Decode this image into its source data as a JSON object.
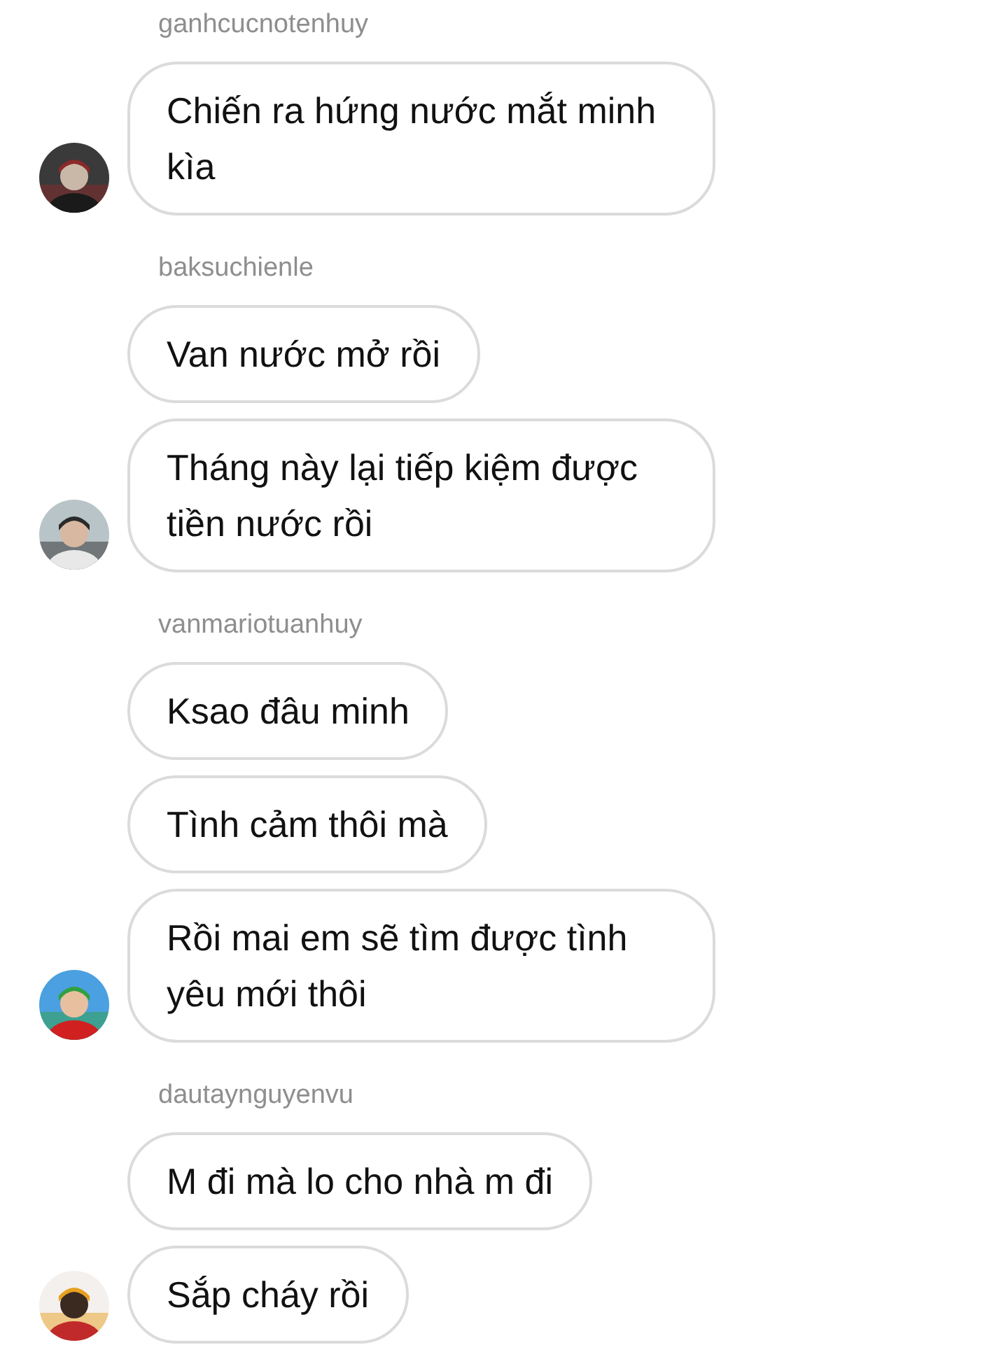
{
  "groups": [
    {
      "sender": "ganhcucnotenhuy",
      "messages": [
        "Chiến ra hứng nước mắt minh kìa"
      ]
    },
    {
      "sender": "baksuchienle",
      "messages": [
        "Van nước mở rồi",
        "Tháng này lại tiếp kiệm được tiền nước rồi"
      ]
    },
    {
      "sender": "vanmariotuanhuy",
      "messages": [
        "Ksao đâu minh",
        "Tình cảm thôi mà",
        "Rồi mai em sẽ tìm được tình yêu mới thôi"
      ]
    },
    {
      "sender": "dautaynguyenvu",
      "messages": [
        "M đi mà lo cho nhà m đi",
        "Sắp cháy rồi"
      ]
    }
  ]
}
